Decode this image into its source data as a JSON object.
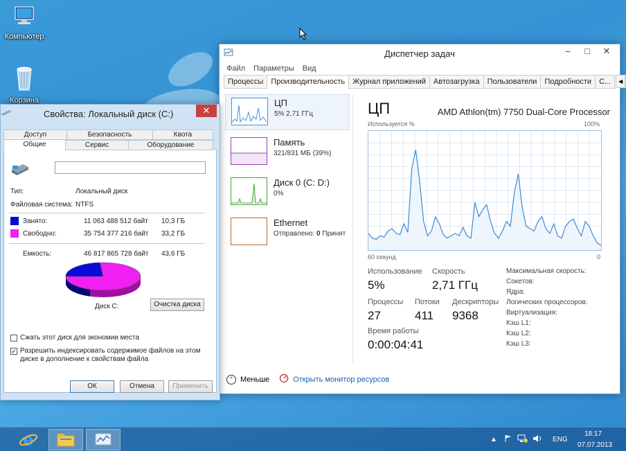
{
  "desktop": {
    "icons": [
      {
        "label": "Компьютер"
      },
      {
        "label": "Корзина"
      }
    ]
  },
  "task_manager": {
    "title": "Диспетчер задач",
    "menu": [
      "Файл",
      "Параметры",
      "Вид"
    ],
    "tabs": [
      "Процессы",
      "Производительность",
      "Журнал приложений",
      "Автозагрузка",
      "Пользователи",
      "Подробности",
      "С..."
    ],
    "active_tab": "Производительность",
    "resources": [
      {
        "name": "ЦП",
        "value": "5% 2,71 ГГц",
        "color": "#4a8fd8"
      },
      {
        "name": "Память",
        "value": "321/831 МБ (39%)",
        "color": "#9b3fb5"
      },
      {
        "name": "Диск 0 (C: D:)",
        "value": "0%",
        "color": "#4aa03a"
      },
      {
        "name": "Ethernet",
        "value_label": "Отправлено:",
        "value": "0",
        "value_suffix": "Принят",
        "color": "#b86a32"
      }
    ],
    "detail": {
      "title": "ЦП",
      "model": "AMD Athlon(tm) 7750 Dual-Core Processor",
      "graph_top_left": "Используется %",
      "graph_top_right": "100%",
      "graph_bottom_left": "60 секунд",
      "graph_bottom_right": "0",
      "metrics": {
        "usage_label": "Использование",
        "usage_value": "5%",
        "speed_label": "Скорость",
        "speed_value": "2,71 ГГц",
        "processes_label": "Процессы",
        "processes_value": "27",
        "threads_label": "Потоки",
        "threads_value": "411",
        "handles_label": "Дескрипторы",
        "handles_value": "9368",
        "uptime_label": "Время работы",
        "uptime_value": "0:00:04:41"
      },
      "stats": [
        "Максимальная скорость:",
        "Сокетов:",
        "Ядра:",
        "Логических процессоров:",
        "Виртуализация:",
        "Кэш L1:",
        "Кэш L2:",
        "Кэш L3:"
      ]
    },
    "footer": {
      "less_label": "Меньше",
      "monitor_link": "Открыть монитор ресурсов"
    }
  },
  "cpu_graph": [
    14,
    10,
    9,
    12,
    11,
    16,
    18,
    14,
    13,
    22,
    15,
    68,
    84,
    58,
    24,
    12,
    16,
    28,
    22,
    13,
    10,
    12,
    14,
    12,
    19,
    12,
    10,
    40,
    28,
    34,
    38,
    24,
    14,
    10,
    16,
    24,
    20,
    48,
    64,
    36,
    20,
    18,
    16,
    24,
    28,
    18,
    14,
    22,
    12,
    10,
    20,
    24,
    26,
    18,
    12,
    24,
    20,
    12,
    6,
    4
  ],
  "properties": {
    "title": "Свойства: Локальный диск (C:)",
    "tabs_row1": [
      "Доступ",
      "Безопасность",
      "Квота"
    ],
    "tabs_row2": [
      "Общие",
      "Сервис",
      "Оборудование"
    ],
    "type_label": "Тип:",
    "type_value": "Локальный диск",
    "fs_label": "Файловая система:",
    "fs_value": "NTFS",
    "used_label": "Занято:",
    "used_bytes": "11 063 488 512 байт",
    "used_gb": "10,3 ГБ",
    "free_label": "Свободно:",
    "free_bytes": "35 754 377 216 байт",
    "free_gb": "33,2 ГБ",
    "capacity_label": "Емкость:",
    "capacity_bytes": "46 817 865 728 байт",
    "capacity_gb": "43,6 ГБ",
    "disk_label": "Диск C:",
    "cleanup_button": "Очистка диска",
    "compress_label": "Сжать этот диск для экономии места",
    "index_label_1": "Разрешить индексировать содержимое файлов на этом",
    "index_label_2": "диске в дополнение к свойствам файла",
    "ok": "ОК",
    "cancel": "Отмена",
    "apply": "Применить",
    "used_color": "#0b0bd8",
    "free_color": "#f020f0",
    "used_fraction": 0.236
  },
  "taskbar": {
    "language": "ENG",
    "time": "18:17",
    "date": "07.07.2013"
  }
}
